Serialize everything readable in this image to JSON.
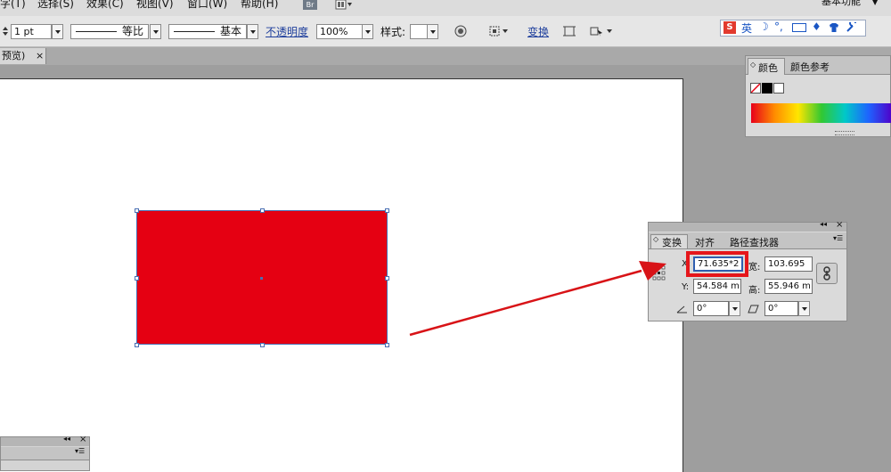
{
  "menu": {
    "items": [
      "字(T)",
      "选择(S)",
      "效果(C)",
      "视图(V)",
      "窗口(W)",
      "帮助(H)"
    ],
    "bridge_badge": "Br",
    "workspace_label": "基本功能"
  },
  "control": {
    "stroke_weight": "1 pt",
    "stroke_profile_label": "等比",
    "brush_label": "基本",
    "opacity_label": "不透明度",
    "opacity_value": "100%",
    "style_label": "样式:",
    "transform_link": "变换"
  },
  "ime": {
    "lang": "英"
  },
  "document_tab": {
    "label": "预览)",
    "close": "×"
  },
  "color_panel": {
    "tabs": [
      "颜色",
      "颜色参考"
    ],
    "fill_color": "#e50012"
  },
  "transform_panel": {
    "tabs": [
      "变换",
      "对齐",
      "路径查找器"
    ],
    "x_label": "X:",
    "x_value": "71.635*2",
    "y_label": "Y:",
    "y_value": "54.584 m",
    "w_label": "宽:",
    "w_value": "103.695",
    "h_label": "高:",
    "h_value": "55.946 m",
    "rotate_value": "0°",
    "shear_value": "0°"
  },
  "accent_colors": {
    "highlight": "#e5161b",
    "arrow": "#d81317"
  }
}
